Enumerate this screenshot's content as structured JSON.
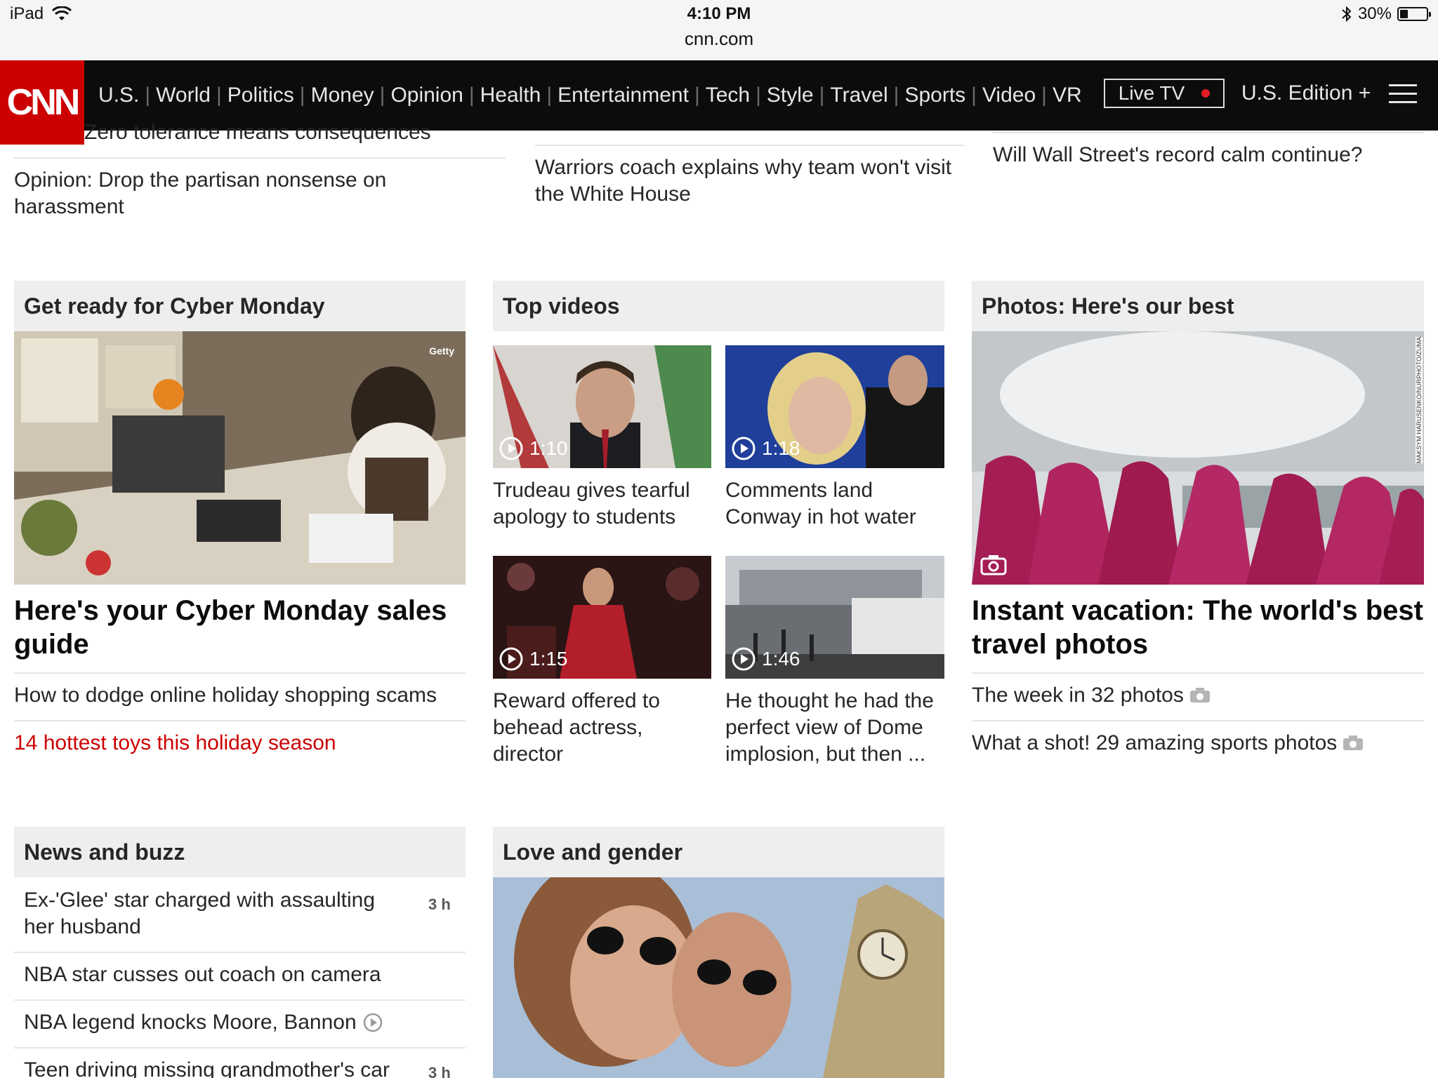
{
  "status_bar": {
    "device": "iPad",
    "time": "4:10 PM",
    "url": "cnn.com",
    "battery": "30%",
    "battery_level": 0.3
  },
  "nav": {
    "logo": "CNN",
    "links": [
      "U.S.",
      "World",
      "Politics",
      "Money",
      "Opinion",
      "Health",
      "Entertainment",
      "Tech",
      "Style",
      "Travel",
      "Sports",
      "Video",
      "VR"
    ],
    "live_tv": "Live TV",
    "edition": "U.S. Edition +",
    "colors": {
      "bar": "#0c0c0c",
      "logo": "#cc0000",
      "live_dot": "#e31b23"
    }
  },
  "top_stories": {
    "col1": {
      "partial": "Zero tolerance means consequences",
      "headline": "Opinion: Drop the partisan nonsense on harassment"
    },
    "col2": {
      "headline": "Warriors coach explains why team won't visit the White House"
    },
    "col3": {
      "headline": "Will Wall Street's record calm continue?"
    }
  },
  "cyber": {
    "header": "Get ready for Cyber Monday",
    "image_credit": "Getty",
    "headline": "Here's your Cyber Monday sales guide",
    "links": [
      "How to dodge online holiday shopping scams",
      "14 hottest toys this holiday season"
    ]
  },
  "videos": {
    "header": "Top videos",
    "items": [
      {
        "duration": "1:10",
        "title": "Trudeau gives tearful apology to students"
      },
      {
        "duration": "1:18",
        "title": "Comments land Conway in hot water"
      },
      {
        "duration": "1:15",
        "title": "Reward offered to behead actress, director"
      },
      {
        "duration": "1:46",
        "title": "He thought he had the perfect view of Dome implosion, but then ..."
      }
    ]
  },
  "photos": {
    "header": "Photos: Here's our best",
    "image_credit": "MAKSYM HARUSENKO/NURPHOTO/ZUMA",
    "headline": "Instant vacation: The world's best travel photos",
    "links": [
      "The week in 32 photos",
      "What a shot! 29 amazing sports photos"
    ]
  },
  "news": {
    "header": "News and buzz",
    "items": [
      {
        "title": "Ex-'Glee' star charged with assaulting her husband",
        "time": "3 h"
      },
      {
        "title": "NBA star cusses out coach on camera",
        "time": ""
      },
      {
        "title": "NBA legend knocks Moore, Bannon",
        "time": ""
      },
      {
        "title": "Teen driving missing grandmother's car",
        "time": "3 h"
      }
    ]
  },
  "love": {
    "header": "Love and gender"
  }
}
